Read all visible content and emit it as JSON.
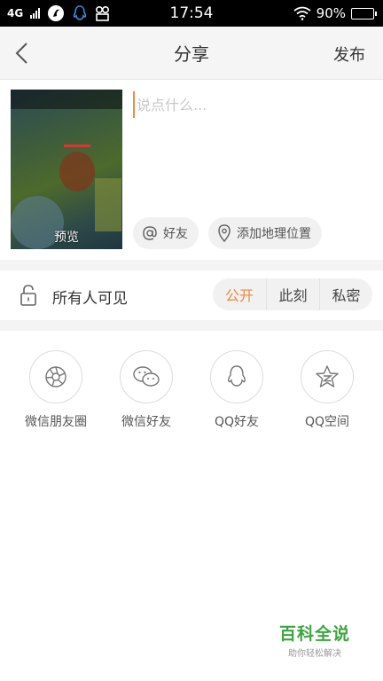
{
  "status_bar": {
    "network": "4G",
    "time": "17:54",
    "battery": "90%",
    "battery_level": 0.9
  },
  "header": {
    "title": "分享",
    "publish_label": "发布"
  },
  "compose": {
    "placeholder": "说点什么...",
    "preview_label": "预览",
    "mention_label": "好友",
    "location_label": "添加地理位置"
  },
  "visibility": {
    "label": "所有人可见",
    "options": [
      "公开",
      "此刻",
      "私密"
    ],
    "selected": "公开",
    "accent_color": "#f0883a"
  },
  "share_targets": [
    {
      "label": "微信朋友圈",
      "icon": "wechat-moments-icon"
    },
    {
      "label": "微信好友",
      "icon": "wechat-icon"
    },
    {
      "label": "QQ好友",
      "icon": "qq-icon"
    },
    {
      "label": "QQ空间",
      "icon": "qzone-icon"
    }
  ],
  "watermark": {
    "title": "百科全说",
    "subtitle": "助你轻松解决"
  }
}
